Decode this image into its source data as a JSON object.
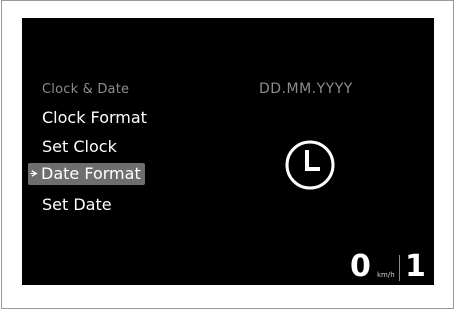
{
  "menu": {
    "title": "Clock & Date",
    "items": [
      {
        "label": "Clock Format"
      },
      {
        "label": "Set Clock"
      },
      {
        "label": "Date Format",
        "selected": true
      },
      {
        "label": "Set Date"
      }
    ]
  },
  "preview": {
    "format_value": "DD.MM.YYYY",
    "icon": "clock-icon"
  },
  "status": {
    "speed": "0",
    "speed_unit": "km/h",
    "gear": "1"
  },
  "colors": {
    "screen_background": "#000000",
    "text_primary": "#ffffff",
    "text_secondary": "#8c8c8c",
    "selection_highlight": "#6e6e6e"
  }
}
